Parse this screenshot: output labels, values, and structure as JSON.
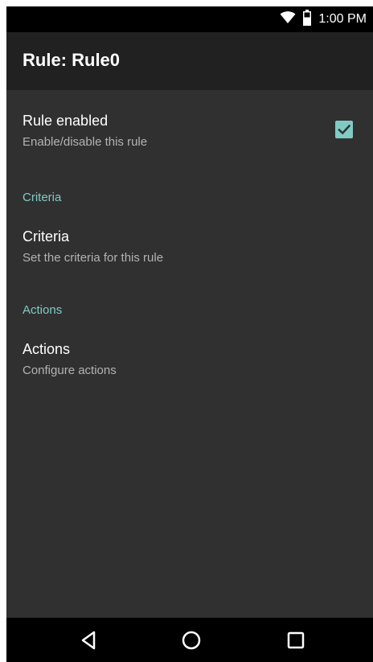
{
  "status_bar": {
    "time": "1:00 PM",
    "icons": [
      "wifi-icon",
      "battery-icon"
    ]
  },
  "app_bar": {
    "title": "Rule: Rule0"
  },
  "preferences": {
    "rule_enabled": {
      "title": "Rule enabled",
      "summary": "Enable/disable this rule",
      "checked": true
    },
    "criteria_category": "Criteria",
    "criteria": {
      "title": "Criteria",
      "summary": "Set the criteria for this rule"
    },
    "actions_category": "Actions",
    "actions": {
      "title": "Actions",
      "summary": "Configure actions"
    }
  },
  "nav_bar": {
    "buttons": [
      "back-icon",
      "home-icon",
      "recents-icon"
    ]
  },
  "colors": {
    "accent": "#80cbc4",
    "background": "#303030",
    "app_bar": "#212121",
    "system_bars": "#000000"
  }
}
